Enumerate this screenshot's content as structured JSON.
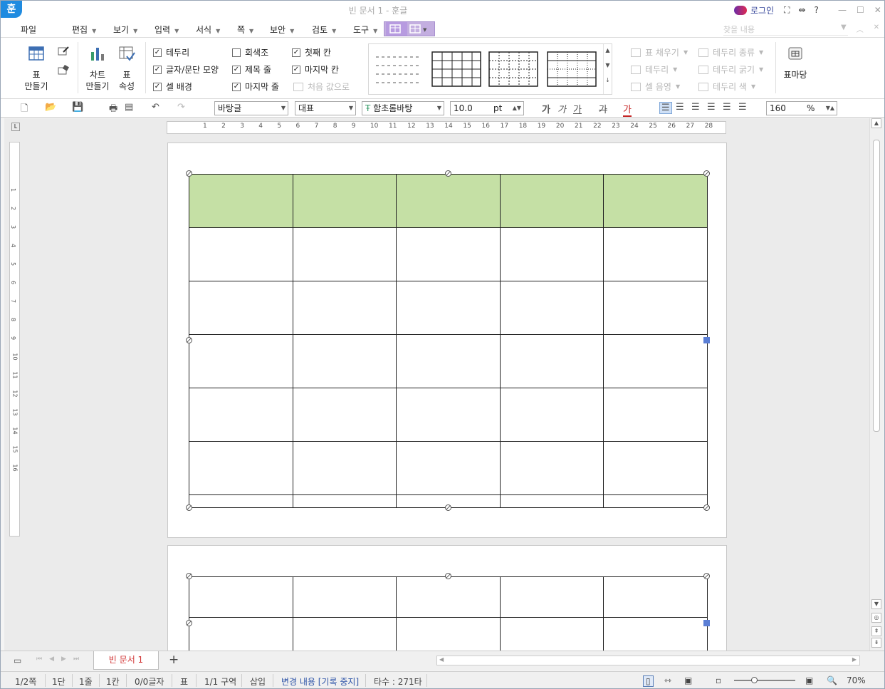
{
  "window": {
    "title": "빈 문서 1 - 훈글",
    "app_logo": "훈",
    "login": "로그인"
  },
  "menu": {
    "items": [
      "파일",
      "편집",
      "보기",
      "입력",
      "서식",
      "쪽",
      "보안",
      "검토",
      "도구"
    ],
    "search_placeholder": "찾을 내용"
  },
  "ribbon": {
    "make_table_1": "표",
    "make_table_2": "만들기",
    "chart_1": "차트",
    "chart_2": "만들기",
    "props_1": "표",
    "props_2": "속성",
    "checks": {
      "border": "테두리",
      "char_para": "글자/문단 모양",
      "cell_bg": "셀 배경",
      "gray": "회색조",
      "title_row": "제목 줄",
      "last_row": "마지막 줄",
      "first_col": "첫째 칸",
      "last_col": "마지막 칸",
      "reset": "처음 값으로"
    },
    "right": {
      "fill": "표 채우기",
      "border": "테두리",
      "shade": "셀 음영",
      "border_type": "테두리 종류",
      "border_width": "테두리 굵기",
      "border_color": "테두리 색",
      "table_madang": "표마당"
    }
  },
  "toolbar": {
    "style": "바탕글",
    "lang": "대표",
    "font": "함초롬바탕",
    "size": "10.0",
    "unit": "pt",
    "zoom": "160",
    "zoom_unit": "%",
    "bold": "가",
    "italic": "가",
    "underline": "가",
    "strike": "가",
    "color": "가"
  },
  "ruler": {
    "h_ticks": [
      "1",
      "2",
      "3",
      "4",
      "5",
      "6",
      "7",
      "8",
      "9",
      "10",
      "11",
      "12",
      "13",
      "14",
      "15",
      "16",
      "17",
      "18",
      "19",
      "20",
      "21",
      "22",
      "23",
      "24",
      "25",
      "26",
      "27",
      "28"
    ],
    "v_ticks": [
      "1",
      "2",
      "3",
      "4",
      "5",
      "6",
      "7",
      "8",
      "9",
      "10",
      "11",
      "12",
      "13",
      "14",
      "15",
      "16"
    ]
  },
  "tabs": {
    "doc_name": "빈 문서 1",
    "add": "+"
  },
  "status": {
    "page": "1/2쪽",
    "col": "1단",
    "line": "1줄",
    "cell": "1칸",
    "chars": "0/0글자",
    "mode": "표",
    "section": "1/1 구역",
    "insert": "삽입",
    "track": "변경 내용 [기록 중지]",
    "typing": "타수 : 271타",
    "zoom": "70%"
  },
  "colors": {
    "header_fill": "#c5e0a5",
    "accent": "#5b7fd6",
    "tab_text": "#d23838"
  }
}
